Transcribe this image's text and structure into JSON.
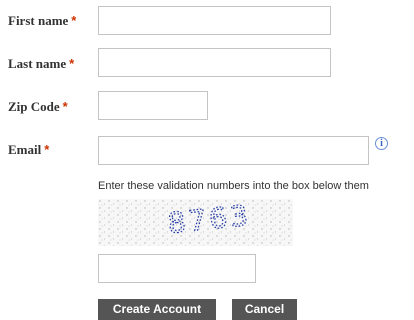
{
  "form": {
    "first_name": {
      "label": "First name",
      "required_mark": "*",
      "value": ""
    },
    "last_name": {
      "label": "Last name",
      "required_mark": "*",
      "value": ""
    },
    "zip_code": {
      "label": "Zip Code",
      "required_mark": "*",
      "value": ""
    },
    "email": {
      "label": "Email",
      "required_mark": "*",
      "value": "",
      "info_glyph": "i"
    },
    "captcha_instructions": "Enter these validation numbers into the box below them",
    "captcha_digits": "8763",
    "captcha_value": ""
  },
  "buttons": {
    "create_label": "Create Account",
    "cancel_label": "Cancel"
  },
  "colors": {
    "required": "#cc3300",
    "button_bg": "#555555",
    "captcha_text": "#2a3fa8"
  }
}
